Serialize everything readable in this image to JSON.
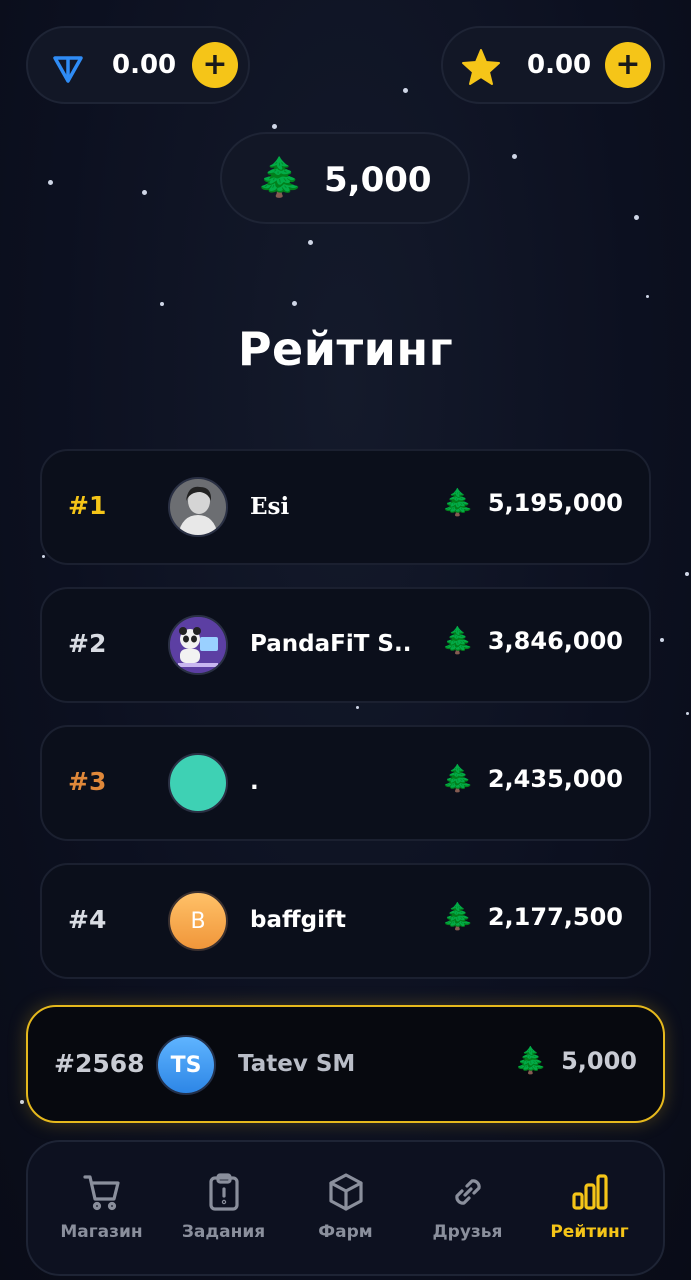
{
  "balances": {
    "ton": {
      "icon": "ton-icon",
      "value": "0.00",
      "add_label": "+"
    },
    "stars": {
      "icon": "star-icon",
      "value": "0.00",
      "add_label": "+"
    },
    "trees": {
      "icon": "tree-icon",
      "emoji": "🌲",
      "value": "5,000"
    }
  },
  "page_title": "Рейтинг",
  "leaderboard": [
    {
      "rank": "#1",
      "name": "Esi",
      "score": "5,195,000",
      "rank_color": "#f5c518",
      "avatar": "photo"
    },
    {
      "rank": "#2",
      "name": "PandaFiT S..",
      "score": "3,846,000",
      "rank_color": "#d9dce3",
      "avatar": "panda"
    },
    {
      "rank": "#3",
      "name": ".",
      "score": "2,435,000",
      "rank_color": "#e0883a",
      "avatar_color": "#3ed1b4"
    },
    {
      "rank": "#4",
      "name": "baffgift",
      "score": "2,177,500",
      "rank_color": "#d9dce3",
      "avatar_letter": "B",
      "avatar_color": "#f5a23c"
    }
  ],
  "current_user": {
    "rank": "#2568",
    "initials": "TS",
    "name": "Tatev SM",
    "score": "5,000"
  },
  "score_icon": "🌲",
  "nav": [
    {
      "label": "Магазин",
      "icon": "cart-icon",
      "active": false
    },
    {
      "label": "Задания",
      "icon": "clipboard-icon",
      "active": false
    },
    {
      "label": "Фарм",
      "icon": "cube-icon",
      "active": false
    },
    {
      "label": "Друзья",
      "icon": "link-icon",
      "active": false
    },
    {
      "label": "Рейтинг",
      "icon": "bar-chart-icon",
      "active": true
    }
  ],
  "colors": {
    "accent": "#f5c518",
    "ton": "#2f8cf5",
    "current_user_border": "#e6b91d"
  }
}
